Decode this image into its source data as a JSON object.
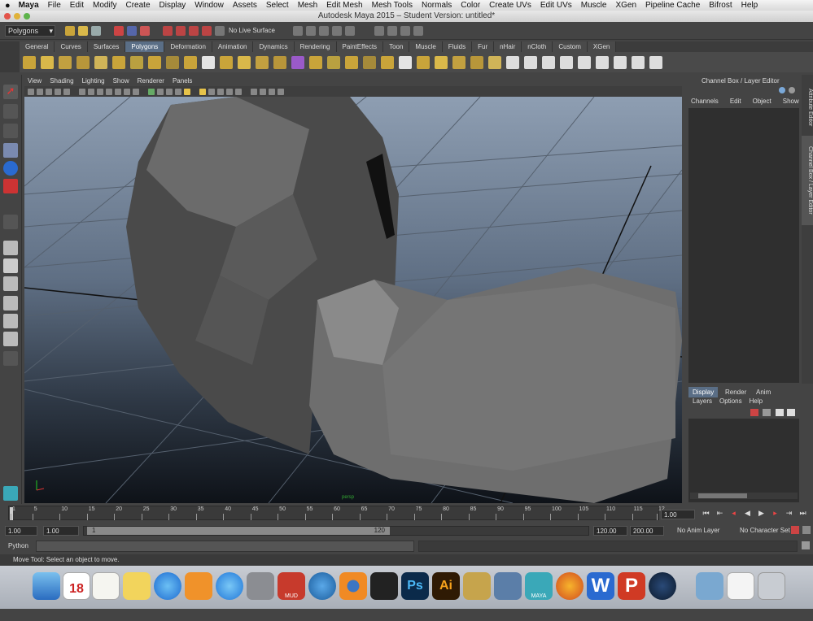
{
  "mac_menu": {
    "app": "Maya",
    "items": [
      "File",
      "Edit",
      "Modify",
      "Create",
      "Display",
      "Window",
      "Assets",
      "Select",
      "Mesh",
      "Edit Mesh",
      "Mesh Tools",
      "Normals",
      "Color",
      "Create UVs",
      "Edit UVs",
      "Muscle",
      "XGen",
      "Pipeline Cache",
      "Bifrost",
      "Help"
    ]
  },
  "window": {
    "title": "Autodesk Maya 2015 – Student Version: untitled*"
  },
  "status_line": {
    "menu_set": "Polygons",
    "live_surface": "No Live Surface"
  },
  "shelf": {
    "tabs": [
      "General",
      "Curves",
      "Surfaces",
      "Polygons",
      "Deformation",
      "Animation",
      "Dynamics",
      "Rendering",
      "PaintEffects",
      "Toon",
      "Muscle",
      "Fluids",
      "Fur",
      "nHair",
      "nCloth",
      "Custom",
      "XGen"
    ],
    "active_tab": "Polygons"
  },
  "viewport": {
    "menu": [
      "View",
      "Shading",
      "Lighting",
      "Show",
      "Renderer",
      "Panels"
    ],
    "camera_label": "persp"
  },
  "channel_box": {
    "title": "Channel Box / Layer Editor",
    "menu": [
      "Channels",
      "Edit",
      "Object",
      "Show"
    ],
    "side_tabs": [
      "Attribute Editor",
      "Channel Box / Layer Editor"
    ]
  },
  "layer_editor": {
    "tabs": [
      "Display",
      "Render",
      "Anim"
    ],
    "active_tab": "Display",
    "menu": [
      "Layers",
      "Options",
      "Help"
    ]
  },
  "time_slider": {
    "ticks": [
      "1",
      "5",
      "10",
      "15",
      "20",
      "25",
      "30",
      "35",
      "40",
      "45",
      "50",
      "55",
      "60",
      "65",
      "70",
      "75",
      "80",
      "85",
      "90",
      "95",
      "100",
      "105",
      "110",
      "115",
      "12"
    ],
    "current_frame": "1.00"
  },
  "range_slider": {
    "start": "1.00",
    "playback_start": "1.00",
    "range_start_label": "1",
    "range_end_label": "120",
    "playback_end": "120.00",
    "end": "200.00",
    "anim_layer": "No Anim Layer",
    "character_set": "No Character Set"
  },
  "command_line": {
    "label": "Python"
  },
  "help_line": {
    "text": "Move Tool: Select an object to move."
  },
  "dock": {
    "calendar_day": "18",
    "app_labels": [
      "MUD",
      "MAYA"
    ]
  }
}
